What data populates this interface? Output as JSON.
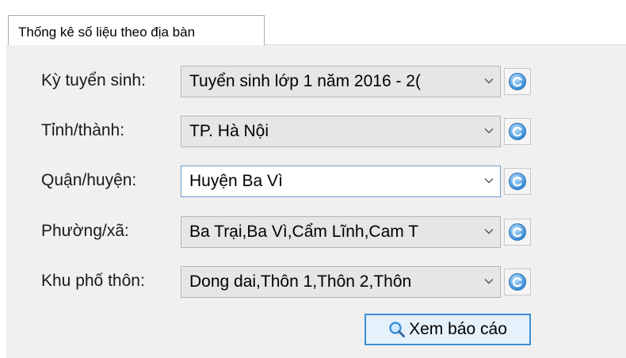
{
  "tab": {
    "label": "Thống kê số liệu theo địa bàn"
  },
  "form": {
    "rows": [
      {
        "label": "Kỳ tuyển sinh:",
        "value": "Tuyển sinh lớp 1 năm 2016 - 2("
      },
      {
        "label": "Tỉnh/thành:",
        "value": "TP. Hà Nội"
      },
      {
        "label": "Quận/huyện:",
        "value": "Huyện Ba Vì"
      },
      {
        "label": "Phường/xã:",
        "value": "Ba Trại,Ba Vì,Cẩm Lĩnh,Cam T"
      },
      {
        "label": "Khu phố thôn:",
        "value": "Dong dai,Thôn 1,Thôn 2,Thôn"
      }
    ]
  },
  "button": {
    "label": "Xem báo cáo",
    "icon": "magnifier-icon"
  },
  "icons": {
    "refresh": "refresh-icon",
    "dropdown": "chevron-down-icon"
  },
  "colors": {
    "panel_bg": "#f0f0f0",
    "button_border": "#3b8fd6",
    "focus_border": "#6a9ccf"
  }
}
